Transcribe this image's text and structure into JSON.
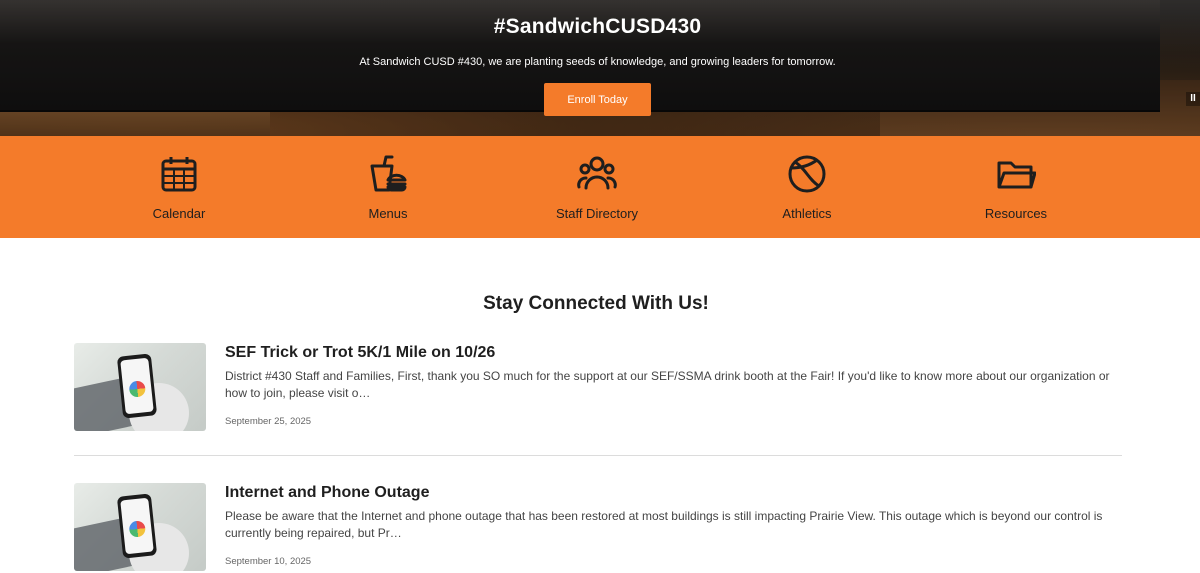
{
  "hero": {
    "title": "#SandwichCUSD430",
    "subtitle": "At Sandwich CUSD #430, we are planting seeds of knowledge, and growing leaders for tomorrow.",
    "cta_label": "Enroll Today",
    "pause_label": "II"
  },
  "quick_links": [
    {
      "label": "Calendar",
      "icon": "calendar-icon"
    },
    {
      "label": "Menus",
      "icon": "food-menu-icon"
    },
    {
      "label": "Staff Directory",
      "icon": "people-icon"
    },
    {
      "label": "Athletics",
      "icon": "ball-icon"
    },
    {
      "label": "Resources",
      "icon": "folder-icon"
    }
  ],
  "section": {
    "title": "Stay Connected With Us!"
  },
  "posts": [
    {
      "title": "SEF Trick or Trot 5K/1 Mile on 10/26",
      "excerpt": "District #430 Staff and Families, First, thank you SO much for the support at our SEF/SSMA drink booth at the Fair! If you'd like to know more about our organization or how to join, please visit o…",
      "date": "September 25, 2025"
    },
    {
      "title": "Internet and Phone Outage",
      "excerpt": "Please be aware that the Internet and phone outage that has been restored at most buildings is still impacting Prairie View. This outage which is beyond our control is currently being repaired, but Pr…",
      "date": "September 10, 2025"
    }
  ],
  "colors": {
    "accent": "#f47b2a",
    "icon": "#1e1e1e"
  }
}
